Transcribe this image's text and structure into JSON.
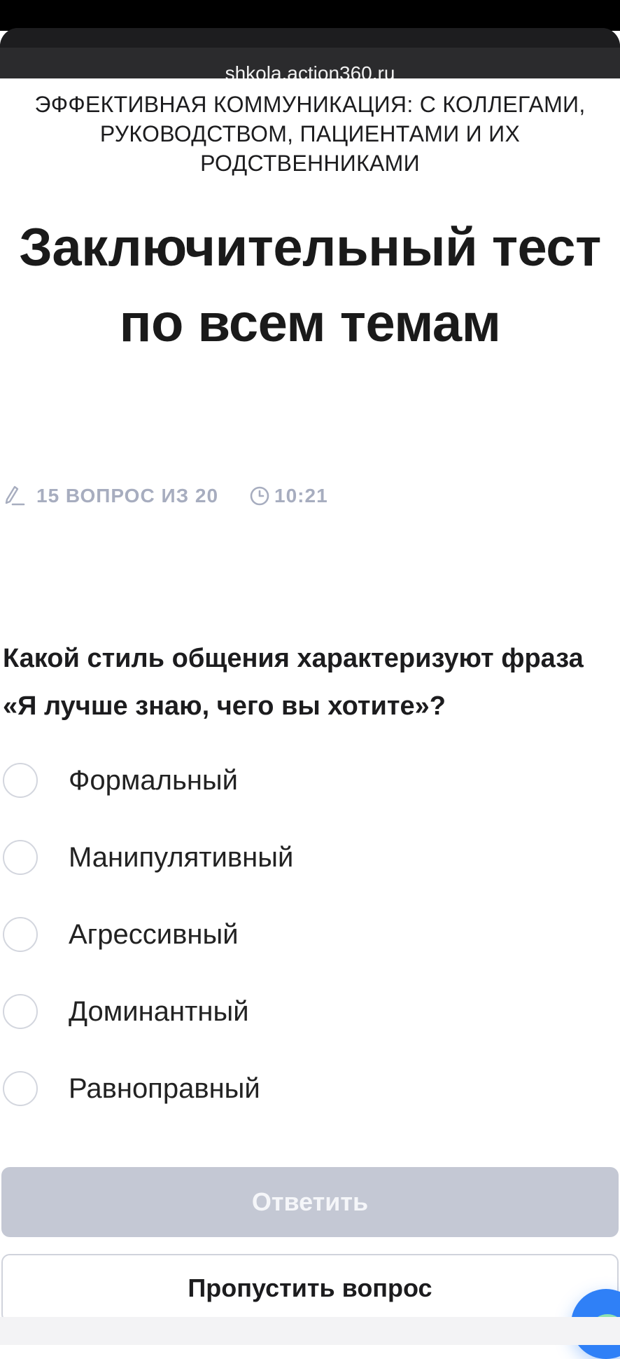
{
  "browser": {
    "url": "shkola.action360.ru"
  },
  "course": {
    "title": "ЭФФЕКТИВНАЯ КОММУНИКАЦИЯ: С КОЛЛЕГАМИ, РУКОВОДСТВОМ, ПАЦИЕНТАМИ И ИХ РОДСТВЕННИКАМИ"
  },
  "test": {
    "title": "Заключительный тест по всем темам"
  },
  "progress": {
    "label": "15 ВОПРОС ИЗ 20",
    "current": 15,
    "total": 20,
    "timer": "10:21"
  },
  "question": {
    "text": "Какой стиль общения характеризуют фраза «Я лучше знаю, чего вы хотите»?",
    "options": [
      {
        "label": "Формальный",
        "selected": false
      },
      {
        "label": "Манипулятивный",
        "selected": false
      },
      {
        "label": "Агрессивный",
        "selected": false
      },
      {
        "label": "Доминантный",
        "selected": false
      },
      {
        "label": "Равноправный",
        "selected": false
      }
    ]
  },
  "actions": {
    "answer_label": "Ответить",
    "answer_disabled": true,
    "skip_label": "Пропустить вопрос"
  },
  "icons": {
    "progress": "pencil-icon",
    "timer": "clock-icon",
    "chat": "chat-bubble-icon"
  },
  "colors": {
    "accent": "#2f80f7",
    "muted_text": "#a7adbf",
    "disabled_button": "#c4c8d4",
    "chat_bubble": "#8ee2b0"
  }
}
